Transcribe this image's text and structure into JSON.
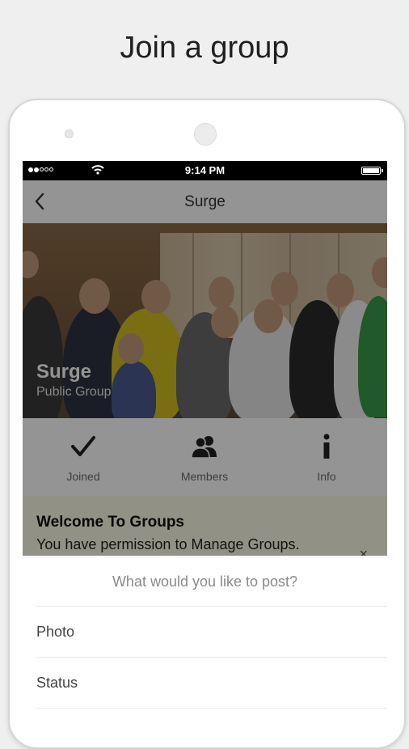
{
  "headline": "Join a group",
  "status_bar": {
    "time": "9:14 PM",
    "signal_icon": "signal-dots-icon",
    "wifi_icon": "wifi-icon",
    "battery_icon": "battery-icon"
  },
  "nav": {
    "title": "Surge",
    "back_icon": "chevron-left-icon"
  },
  "group": {
    "name": "Surge",
    "type": "Public Group"
  },
  "actions": [
    {
      "label": "Joined",
      "icon": "checkmark-icon"
    },
    {
      "label": "Members",
      "icon": "members-icon"
    },
    {
      "label": "Info",
      "icon": "info-icon"
    }
  ],
  "welcome": {
    "title": "Welcome To Groups",
    "text": "You have permission to Manage Groups.",
    "close": "×"
  },
  "post_sheet": {
    "title": "What would you like to post?",
    "items": [
      "Photo",
      "Status"
    ]
  },
  "colors": {
    "background": "#efefef",
    "status_bar": "#000000",
    "welcome_banner": "#fafae6",
    "overlay": "rgba(0,0,0,0.42)"
  }
}
